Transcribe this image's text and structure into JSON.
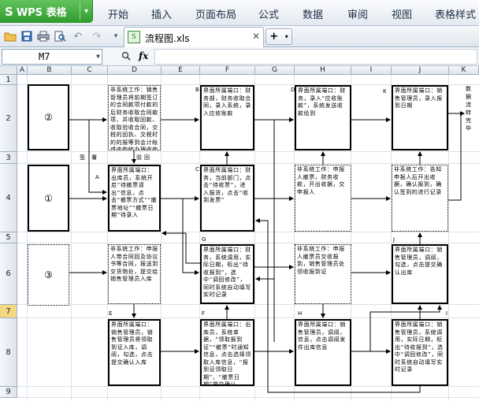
{
  "app": {
    "logo": "S",
    "name": "WPS 表格",
    "dropdown": "▾"
  },
  "menus": [
    "开始",
    "插入",
    "页面布局",
    "公式",
    "数据",
    "审阅",
    "视图",
    "表格样式"
  ],
  "toolbar": {
    "icons": [
      "open-folder-icon",
      "save-icon",
      "print-icon",
      "print-preview-icon",
      "undo-icon",
      "redo-icon",
      "more-icon"
    ],
    "new_tab": "+",
    "new_tab_drop": "▾"
  },
  "doc_tab": {
    "title": "流程图.xls",
    "close": "✕",
    "icon_text": "S"
  },
  "formula_bar": {
    "cell_ref": "M7",
    "zoom_icon": "🔍",
    "fx": "fx",
    "value": ""
  },
  "columns": [
    "A",
    "B",
    "C",
    "D",
    "E",
    "F",
    "G",
    "H",
    "I",
    "J",
    "K"
  ],
  "rows": [
    "1",
    "2",
    "3",
    "4",
    "5",
    "6",
    "7",
    "8",
    "9"
  ],
  "selected_row": "7",
  "roles": {
    "r2": "②",
    "r1": "①",
    "r3": "③"
  },
  "labels": {
    "approve_a": "签",
    "approve_b": "署",
    "reject_a": "驳",
    "reject_b": "回",
    "A": "A",
    "B": "B",
    "C": "C",
    "D": "D",
    "E": "E",
    "F": "F",
    "G": "G",
    "H": "H",
    "I": "I",
    "J": "J",
    "K": "K"
  },
  "boxes": {
    "d2": "非系统工作：销售管理员将前期签订的合同款项付款的后财务收取合同款项、并收取回款、收取验收合同，交税的回执、交税时的的报等到会计帐或收款转办理收款",
    "f2": "界面所属端口：财务部，财务收取合同，录入系统，录入应收账款",
    "h2": "界面所属端口：财务，录入“应收账款”，系统发送收款给到",
    "j2": "界面所属端口：销售管理员，录入报到日期",
    "k2": "数据流转完毕",
    "d4": "界面所属端口：出库员，系统开启“待撤票请出”信息，点击“撤票方式”“撤票地址”“撤票日期”待录入",
    "f4": "界面所属端口：财务，当前部门，点击“待收票”，进入报货，点击“收到发票”",
    "h4": "非系统工作：申报人撤票，财务收款，开出收据，交申报人",
    "j4": "非系统工作：告知申报人后开出收据，确认报到，确认签到的进行记录",
    "d6": "非系统工作：申报人带合同回及协议书等合同，报送到交货物处，提交给销售管理员入库",
    "f6": "界面所属端口：财务，系统调用，实际日期，标出“待收报到”，选中“调回修改”，同时系统自动填写实时记录",
    "h6": "非系统工作：申报人撤票员交收报到，销售管理员处领收报到证",
    "j6": "界面所属端口：销售管理员，调阅，勾选，点击提交确认出库",
    "d8": "界面所属端口：销售管理员，销售管理员将领取到证入库，调阅，勾选，点击提交确认入库",
    "f8": "界面所属端口：出库员，系统单据，“领取报到证”“撤票”时通知信息，点击选择领取入库信息，“报到证领取日期”，“撤票日期”提交确认",
    "h8": "界面所属端口：销售管理员，调阅，信息，点击调阅发件出库信息",
    "j8": "界面所属端口：销售管理员，系统调用，实际日期，标出“待收报到”，选中“调回修改”，同时系统自动填写实时记录"
  }
}
